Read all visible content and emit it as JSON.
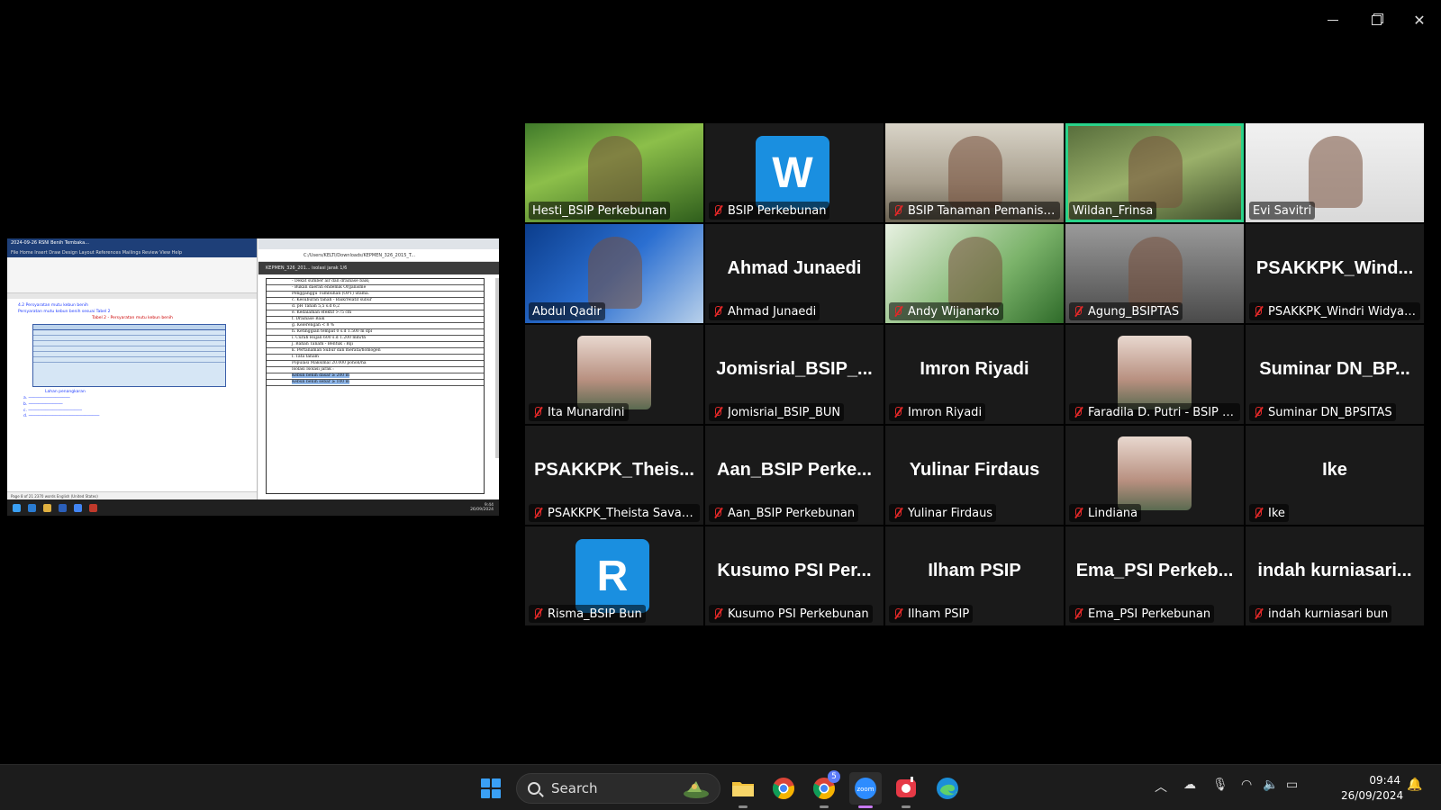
{
  "window": {
    "minimize": "—",
    "maximize": "❐",
    "close": "✕"
  },
  "share": {
    "word_title": "2024-09-26 RSNI Benih Tembaka...",
    "word_menu": "File  Home  Insert  Draw  Design  Layout  References  Mailings  Review  View  Help",
    "word_heading": "4.2 Persyaratan mutu kebun benih",
    "word_subheading": "Persyaratan mutu kebun benih sesuai Tabel 2",
    "word_table_title": "Tabel 2 - Persyaratan mutu kebun benih",
    "word_section": "Lahan penangkaran",
    "word_status": "Page 8 of 21   2370 words   English (United States)",
    "pdf_url": "C:/Users/KELTI/Downloads/KEPMEN_326_2015_T...",
    "pdf_toolbar": "KEPMEN_326_201...        isolasi jarak       1/6",
    "pdf_lines": [
      "- Dekat sumber air dan drainase baik;",
      "- Bukan daerah endemik Organisme",
      "  Pengganggu Tumbuhan (OPT) utama.",
      "c.  Kesuburan tanah       - Baik/relatif subur",
      "d.  pH Tanah              5,5 s.d 6,2",
      "e.  Kedalaman efektif     >75 cm",
      "f.  Drainase              Baik",
      "g.  Kelerengan            < 8 %",
      "h.  Ketinggian tempat     0 s.d 1.500 m dpl",
      "i.  Curah Hujan           600 s.d 1.200 mm/th",
      "j.  Bahan Tanam           - Bentuk : Biji",
      "k.  Pertanaman            Subur dan merata/homogen",
      "l.  Tata tanam",
      "    Populasi              Maksimal 20.000 pohon/ha",
      "    Isolasi               Isolasi jarak :"
    ],
    "pdf_highlight_1": "Kebun benih dasar ≥ 200 m",
    "pdf_highlight_2": "Kebun benih sebar ≥ 100 m",
    "share_time": "9:44",
    "share_date": "26/09/2024"
  },
  "participants": [
    {
      "name": "Hesti_BSIP Perkebunan",
      "type": "video",
      "muted": false
    },
    {
      "name": "BSIP Perkebunan",
      "type": "letter",
      "letter": "W",
      "color": "#1a8fe0",
      "muted": true
    },
    {
      "name": "BSIP Tanaman Pemanis dan ...",
      "type": "video",
      "muted": true
    },
    {
      "name": "Wildan_Frinsa",
      "type": "video",
      "muted": false,
      "active": true
    },
    {
      "name": "Evi Savitri",
      "type": "video",
      "muted": false
    },
    {
      "name": "Abdul Qadir",
      "type": "video",
      "muted": false
    },
    {
      "name": "Ahmad Junaedi",
      "type": "text",
      "display": "Ahmad Junaedi",
      "muted": true
    },
    {
      "name": "Andy Wijanarko",
      "type": "video",
      "muted": true
    },
    {
      "name": "Agung_BSIPTAS",
      "type": "video",
      "muted": true
    },
    {
      "name": "PSAKKPK_Windri Widyaning...",
      "type": "text",
      "display": "PSAKKPK_Wind...",
      "muted": true
    },
    {
      "name": "Ita Munardini",
      "type": "photo",
      "muted": true
    },
    {
      "name": "Jomisrial_BSIP_BUN",
      "type": "text",
      "display": "Jomisrial_BSIP_...",
      "muted": true
    },
    {
      "name": "Imron Riyadi",
      "type": "text",
      "display": "Imron Riyadi",
      "muted": true
    },
    {
      "name": "Faradila D. Putri - BSIP TROA",
      "type": "photo",
      "muted": true
    },
    {
      "name": "Suminar DN_BPSITAS",
      "type": "text",
      "display": "Suminar DN_BP...",
      "muted": true
    },
    {
      "name": "PSAKKPK_Theista Savanty",
      "type": "text",
      "display": "PSAKKPK_Theis...",
      "muted": true
    },
    {
      "name": "Aan_BSIP Perkebunan",
      "type": "text",
      "display": "Aan_BSIP Perke...",
      "muted": true
    },
    {
      "name": "Yulinar Firdaus",
      "type": "text",
      "display": "Yulinar Firdaus",
      "muted": true
    },
    {
      "name": "Lindiana",
      "type": "photo",
      "muted": true
    },
    {
      "name": "Ike",
      "type": "text",
      "display": "Ike",
      "muted": true
    },
    {
      "name": "Risma_BSIP Bun",
      "type": "letter",
      "letter": "R",
      "color": "#1a8fe0",
      "muted": true
    },
    {
      "name": "Kusumo PSI Perkebunan",
      "type": "text",
      "display": "Kusumo PSI Per...",
      "muted": true
    },
    {
      "name": "Ilham PSIP",
      "type": "text",
      "display": "Ilham PSIP",
      "muted": true
    },
    {
      "name": "Ema_PSI Perkebunan",
      "type": "text",
      "display": "Ema_PSI Perkeb...",
      "muted": true
    },
    {
      "name": "indah kurniasari bun",
      "type": "text",
      "display": "indah kurniasari...",
      "muted": true
    }
  ],
  "taskbar": {
    "search_placeholder": "Search",
    "time": "09:44",
    "date": "26/09/2024",
    "chrome_badge": "5"
  }
}
